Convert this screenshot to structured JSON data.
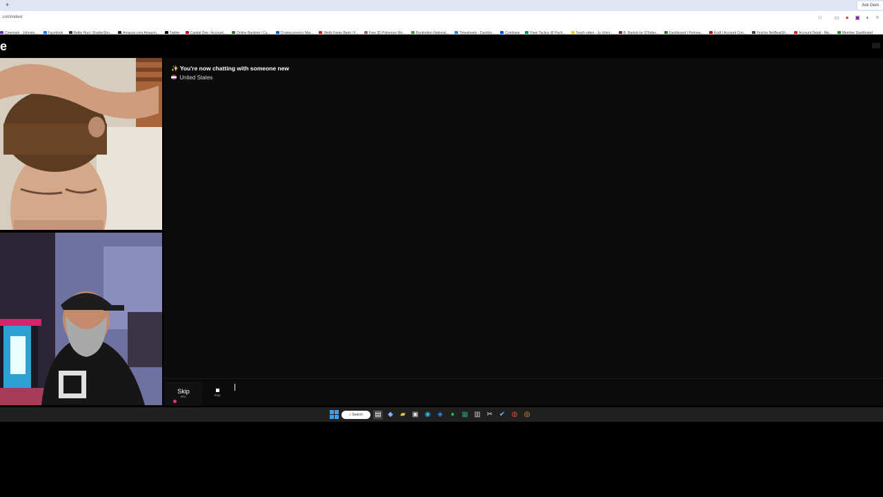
{
  "browser": {
    "new_tab_symbol": "+",
    "right_tab_label": "Ask Gem",
    "url": ".com/video/",
    "bookmarks": [
      {
        "label": "Cinemark - Johnsto...",
        "color": "#6a3aa8"
      },
      {
        "label": "Facebook",
        "color": "#1877f2"
      },
      {
        "label": "Battle Hug | ShatterSho...",
        "color": "#333"
      },
      {
        "label": "Amazon.com Amazon...",
        "color": "#222"
      },
      {
        "label": "Twitter",
        "color": "#000"
      },
      {
        "label": "Capital One | Account...",
        "color": "#c8102e"
      },
      {
        "label": "Online Banking | Cu...",
        "color": "#2e7d32"
      },
      {
        "label": "Cryptocurrency Mar...",
        "color": "#1565c0"
      },
      {
        "label": "Wells Fargo Bank | F...",
        "color": "#c62828"
      },
      {
        "label": "Free 3D Pokemon Mo...",
        "color": "#8d6e63"
      },
      {
        "label": "Huntington National...",
        "color": "#43a047"
      },
      {
        "label": "Timesheets - Dashbo...",
        "color": "#1e88e5"
      },
      {
        "label": "Coinbase",
        "color": "#0052ff"
      },
      {
        "label": "Fleet Tactics @ Pach...",
        "color": "#00897b"
      },
      {
        "label": "Teach video - Ju Ichiro...",
        "color": "#fbc02d"
      },
      {
        "label": "B. Bartolo by GToday...",
        "color": "#5d4037"
      },
      {
        "label": "Dashboard | Perinea...",
        "color": "#2e7d32"
      },
      {
        "label": "Kraft | Account Con...",
        "color": "#b71c1c"
      },
      {
        "label": "Find by NetBeatSh...",
        "color": "#424242"
      },
      {
        "label": "Account Detail - Ma...",
        "color": "#d32f2f"
      },
      {
        "label": "Member Dashboard",
        "color": "#388e3c"
      }
    ]
  },
  "site": {
    "logo_text": "e",
    "chat": {
      "status_icon": "✨",
      "status_text": "You're now chatting with someone new",
      "country": "United States"
    },
    "controls": {
      "skip_label": "Skip",
      "skip_shortcut": "Esc",
      "stop_label": "Stop",
      "message_value": ""
    }
  },
  "taskbar": {
    "search_label": "Search",
    "icons": [
      "file-explorer-icon",
      "copilot-icon",
      "folder-icon",
      "store-icon",
      "edge-icon",
      "vscode-icon",
      "xbox-icon",
      "spreadsheet-icon",
      "calculator-icon",
      "snipping-icon",
      "steam-icon",
      "chrome-icon",
      "chrome-dev-icon"
    ]
  }
}
